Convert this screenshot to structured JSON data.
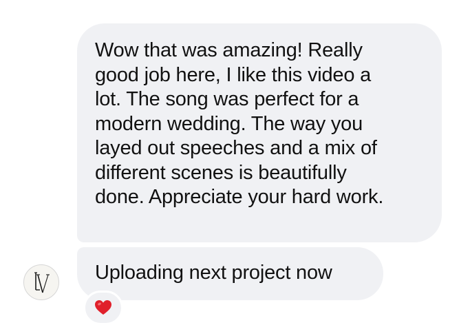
{
  "thread": {
    "messages": [
      {
        "lines": [
          "Wow that was amazing! Really",
          "good job here, I like this video a",
          "lot. The song was perfect for a",
          "modern wedding. The way you",
          "layed out speeches and a mix of",
          "different scenes is beautifully",
          "done. Appreciate your hard work."
        ]
      },
      {
        "text": "Uploading next project now",
        "reaction": "heart-emoji"
      }
    ],
    "sender": {
      "avatar_monogram": "LV"
    }
  },
  "colors": {
    "bubble_background": "#f0f1f4",
    "text": "#111111",
    "heart": "#e0202b"
  }
}
